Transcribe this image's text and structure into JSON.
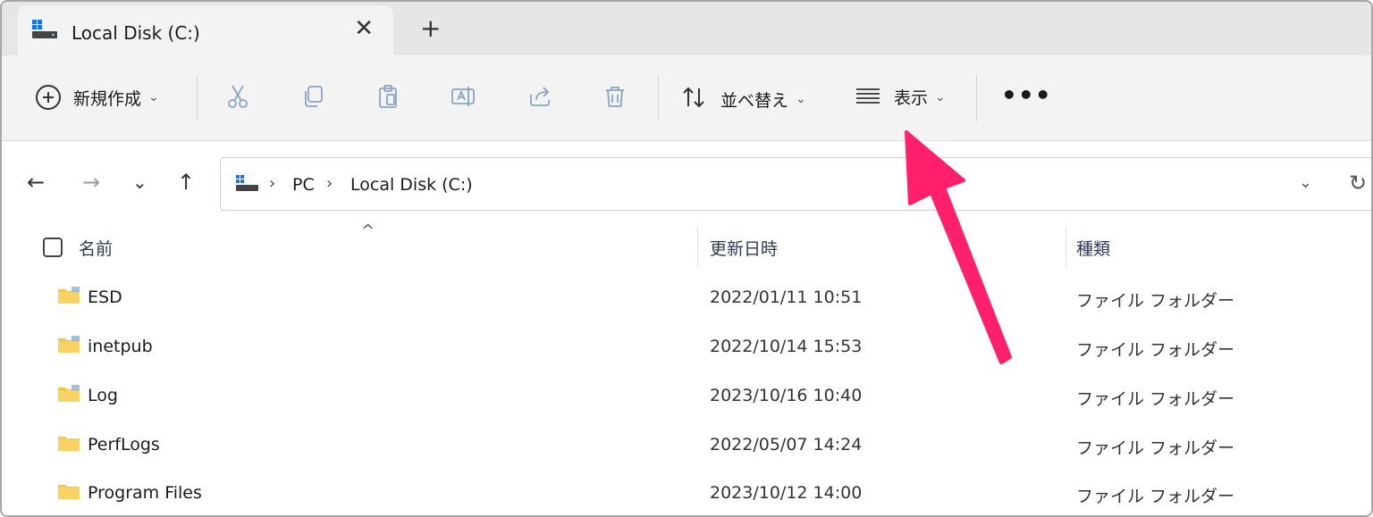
{
  "window": {
    "tab_title": "Local Disk (C:)",
    "tab_close_glyph": "✕",
    "new_tab_glyph": "+"
  },
  "toolbar": {
    "new_label": "新規作成",
    "sort_label": "並べ替え",
    "view_label": "表示",
    "more_glyph": "•••",
    "chevron_glyph": "⌄"
  },
  "nav": {
    "back_glyph": "←",
    "forward_glyph": "→",
    "recent_glyph": "⌄",
    "up_glyph": "↑"
  },
  "address": {
    "crumbs": [
      "PC",
      "Local Disk (C:)"
    ],
    "separator_glyph": "›",
    "dropdown_glyph": "⌄",
    "refresh_glyph": "↻"
  },
  "columns": {
    "name": "名前",
    "modified": "更新日時",
    "type": "種類",
    "sort_caret": "^"
  },
  "files": [
    {
      "name": "ESD",
      "modified": "2022/01/11 10:51",
      "type": "ファイル フォルダー"
    },
    {
      "name": "inetpub",
      "modified": "2022/10/14 15:53",
      "type": "ファイル フォルダー"
    },
    {
      "name": "Log",
      "modified": "2023/10/16 10:40",
      "type": "ファイル フォルダー"
    },
    {
      "name": "PerfLogs",
      "modified": "2022/05/07 14:24",
      "type": "ファイル フォルダー"
    },
    {
      "name": "Program Files",
      "modified": "2023/10/12 14:00",
      "type": "ファイル フォルダー"
    }
  ],
  "colors": {
    "accent_arrow": "#ff1f6b",
    "folder": "#f5c542",
    "drive_blue": "#1a73e8"
  }
}
